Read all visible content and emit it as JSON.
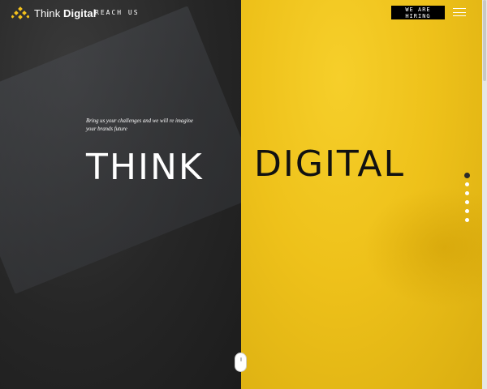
{
  "header": {
    "brand_light": "Think",
    "brand_bold": "Digital",
    "nav_link": "REACH US",
    "hiring_button": "WE ARE HIRING",
    "logo_icon": "diamond-dots-logo",
    "menu_icon": "hamburger-menu-icon"
  },
  "hero": {
    "tagline": "Bring us your challenges and we will re imagine your brands future",
    "word_left": "THINK",
    "word_right": "DIGITAL"
  },
  "colors": {
    "left_panel": "#2b2b2b",
    "right_panel": "#efc41b",
    "accent": "#f4c21c"
  },
  "pagination": {
    "count": 6,
    "active_index": 0
  },
  "scroll_indicator": {
    "icon": "mouse-scroll-icon"
  }
}
